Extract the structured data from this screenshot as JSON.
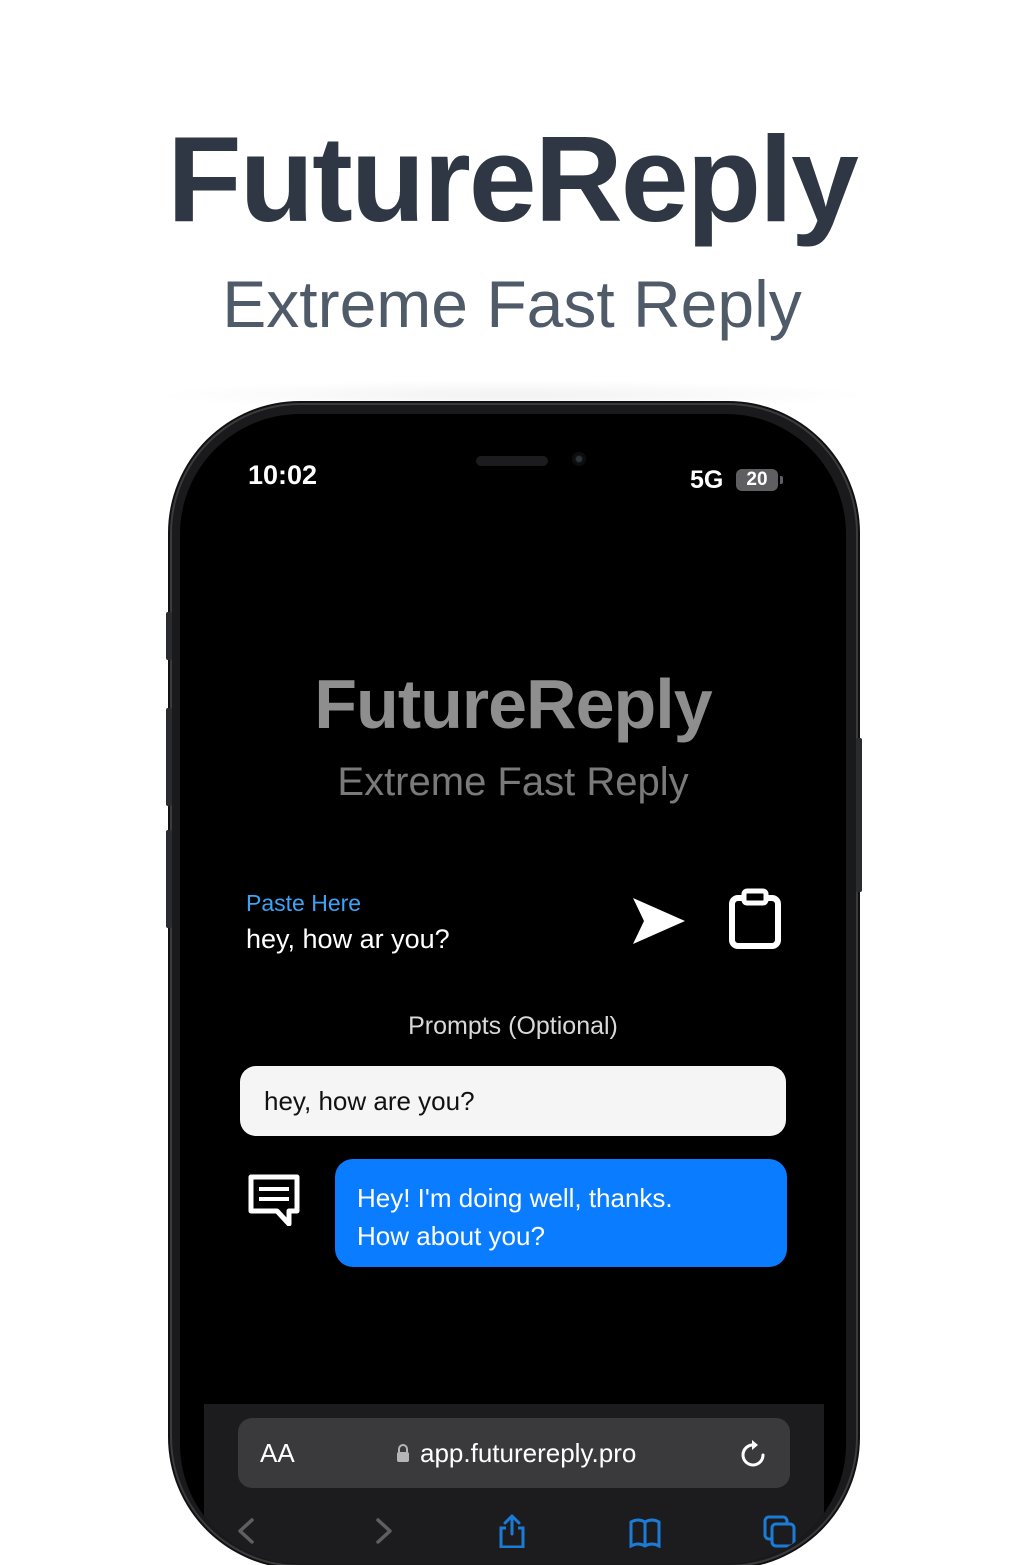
{
  "header": {
    "title": "FutureReply",
    "subtitle": "Extreme Fast Reply"
  },
  "status_bar": {
    "time": "10:02",
    "network": "5G",
    "battery": "20"
  },
  "app": {
    "title": "FutureReply",
    "subtitle": "Extreme Fast Reply",
    "paste_label": "Paste Here",
    "paste_value": "hey, how ar you?",
    "prompts_label": "Prompts (Optional)",
    "prompt_value": "hey, how are you?",
    "reply_line1": "Hey! I'm doing well, thanks.",
    "reply_line2": "How about you?"
  },
  "browser": {
    "aa_label": "AA",
    "url": "app.futurereply.pro"
  },
  "colors": {
    "accent": "#0a7cff",
    "paste_label": "#3da3f5",
    "hero_title": "#2e3743",
    "browser_icon": "#1c7bd6"
  },
  "icons": [
    "send-icon",
    "clipboard-icon",
    "chat-icon",
    "lock-icon",
    "reload-icon",
    "back-icon",
    "forward-icon",
    "share-icon",
    "bookmarks-icon",
    "tabs-icon"
  ]
}
